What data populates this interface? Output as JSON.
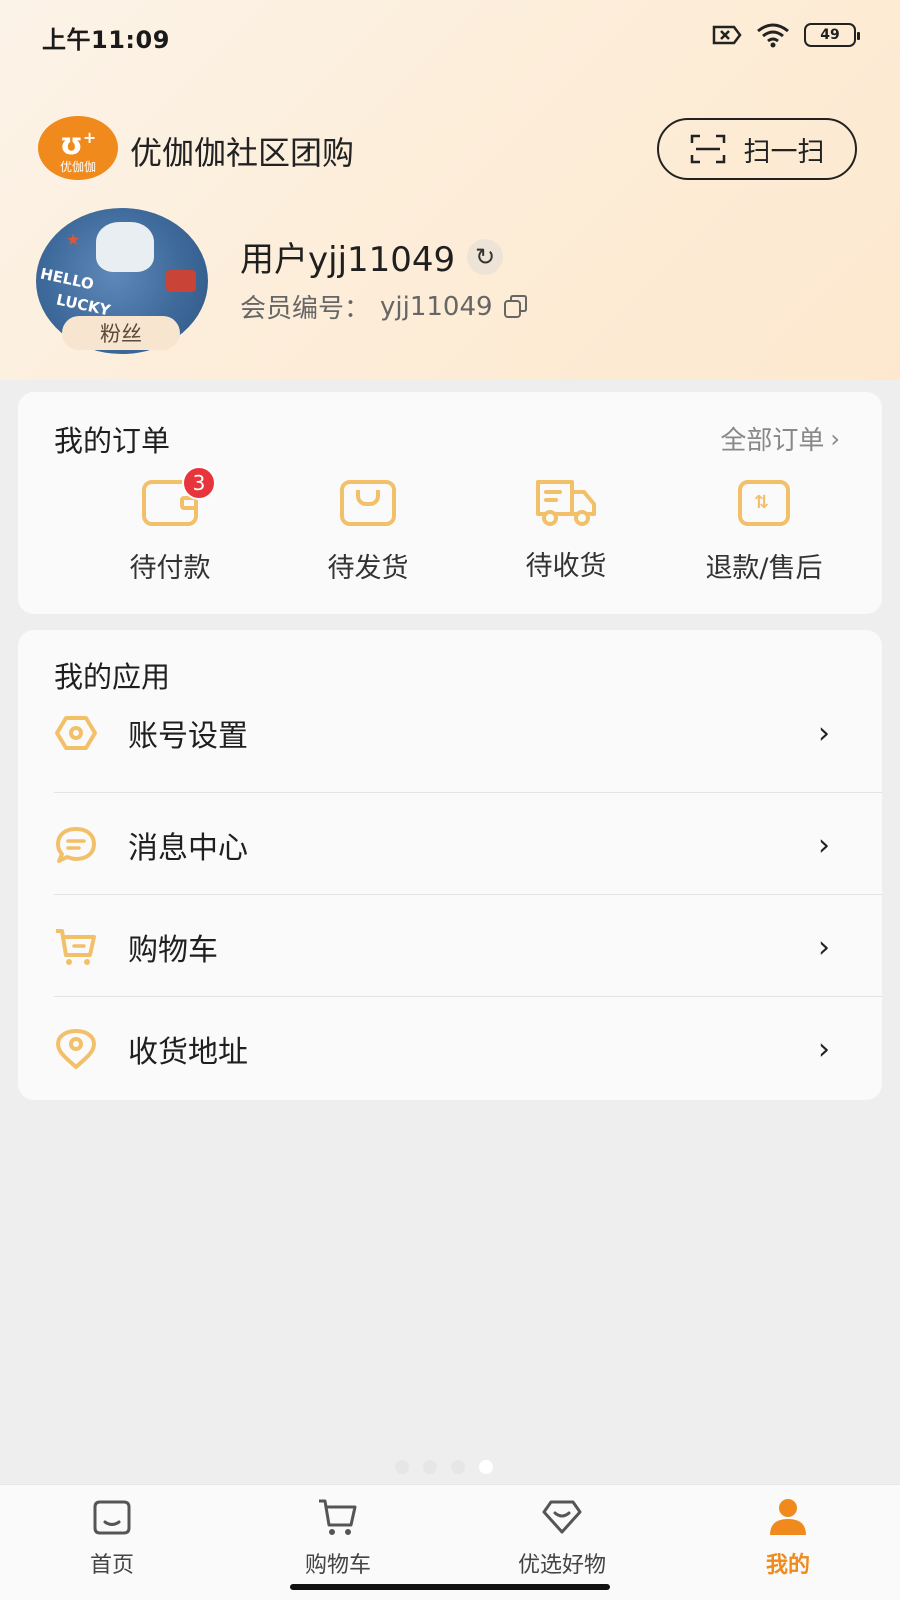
{
  "status_bar": {
    "time": "上午11:09",
    "battery": "49"
  },
  "header": {
    "brand_logo_text": "优伽伽",
    "brand_name": "优伽伽社区团购",
    "scan_label": "扫一扫"
  },
  "profile": {
    "username": "用户yjj11049",
    "member_label": "会员编号：",
    "member_id": "yjj11049",
    "level_badge": "粉丝",
    "avatar_text_1": "HELLO",
    "avatar_text_2": "LUCKY"
  },
  "orders": {
    "title": "我的订单",
    "all_label": "全部订单",
    "items": [
      {
        "label": "待付款",
        "icon": "wallet-icon",
        "badge": "3"
      },
      {
        "label": "待发货",
        "icon": "box-icon"
      },
      {
        "label": "待收货",
        "icon": "truck-icon"
      },
      {
        "label": "退款/售后",
        "icon": "refund-icon"
      }
    ]
  },
  "apps": {
    "title": "我的应用",
    "items": [
      {
        "label": "账号设置",
        "icon": "settings-hex-icon"
      },
      {
        "label": "消息中心",
        "icon": "message-icon"
      },
      {
        "label": "购物车",
        "icon": "cart-icon"
      },
      {
        "label": "收货地址",
        "icon": "location-icon"
      }
    ]
  },
  "bottom_nav": {
    "items": [
      {
        "label": "首页",
        "icon": "home-icon"
      },
      {
        "label": "购物车",
        "icon": "cart-icon"
      },
      {
        "label": "优选好物",
        "icon": "gem-icon"
      },
      {
        "label": "我的",
        "icon": "user-icon",
        "active": true
      }
    ]
  },
  "colors": {
    "accent": "#f08a1c",
    "icon_yellow": "#f3c06a",
    "badge_red": "#e8353c"
  }
}
